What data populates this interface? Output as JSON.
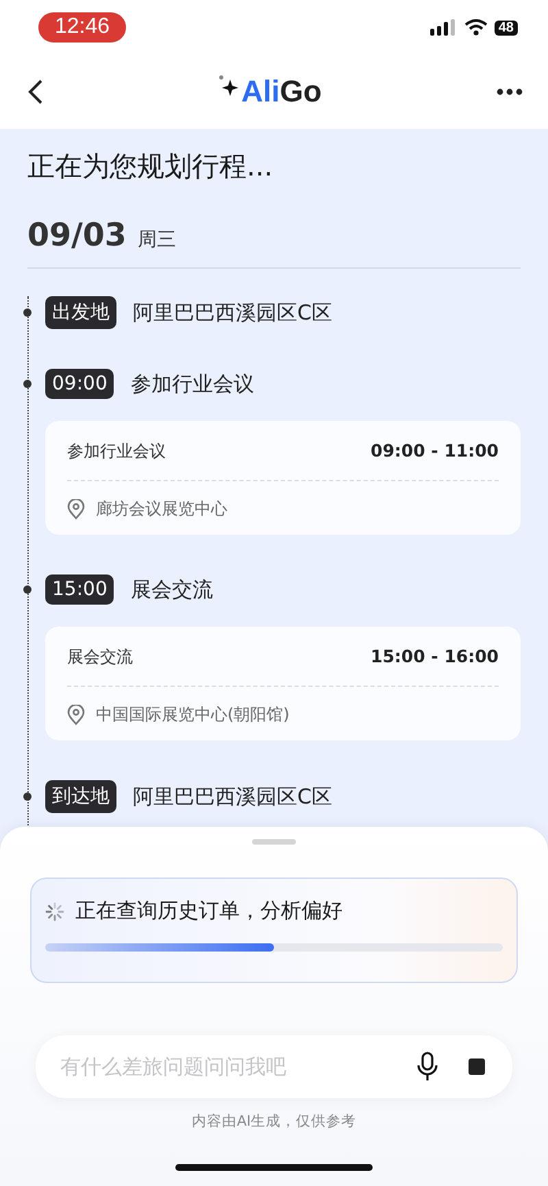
{
  "status_bar": {
    "time": "12:46",
    "battery": "48"
  },
  "nav": {
    "logo": {
      "accent": "Ali",
      "rest": "Go"
    }
  },
  "title": "正在为您规划行程...",
  "date": {
    "day": "09/03",
    "weekday": "周三"
  },
  "timeline": [
    {
      "kind": "place",
      "tag": "出发地",
      "title": "阿里巴巴西溪园区C区"
    },
    {
      "kind": "event",
      "tag": "09:00",
      "title": "参加行业会议",
      "card": {
        "name": "参加行业会议",
        "time": "09:00 - 11:00",
        "location": "廊坊会议展览中心"
      }
    },
    {
      "kind": "event",
      "tag": "15:00",
      "title": "展会交流",
      "card": {
        "name": "展会交流",
        "time": "15:00 - 16:00",
        "location": "中国国际展览中心(朝阳馆)"
      }
    },
    {
      "kind": "place",
      "tag": "到达地",
      "title": "阿里巴巴西溪园区C区"
    }
  ],
  "progress": {
    "text": "正在查询历史订单，分析偏好",
    "level": 0.5
  },
  "input": {
    "placeholder": "有什么差旅问题问问我吧"
  },
  "disclaimer": "内容由AI生成，仅供参考"
}
